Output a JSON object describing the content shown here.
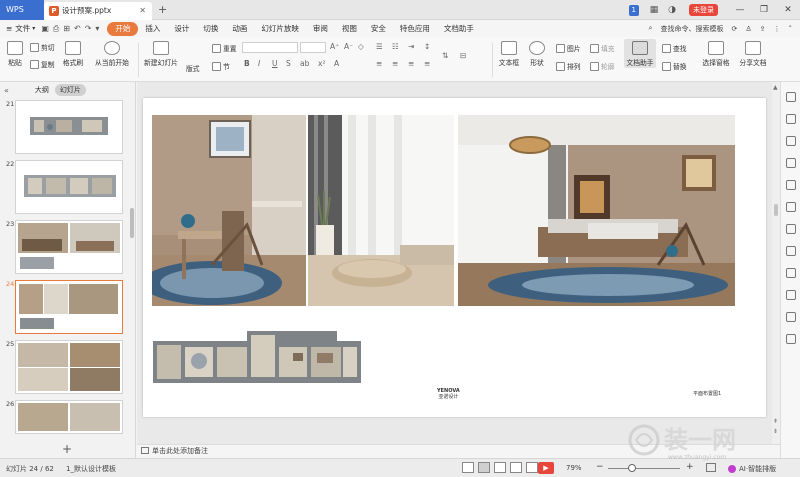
{
  "titlebar": {
    "app_name": "WPS",
    "doc_tab_label": "设计预案.pptx",
    "page_badge": "1",
    "login_label": "未登录"
  },
  "menubar": {
    "file_label": "文件",
    "items": [
      "开始",
      "插入",
      "设计",
      "切换",
      "动画",
      "幻灯片放映",
      "审阅",
      "视图",
      "安全",
      "特色应用",
      "文档助手"
    ],
    "active_index": 0,
    "search_label": "查找命令、搜索模板"
  },
  "ribbon": {
    "paste": "粘贴",
    "cut": "剪切",
    "copy": "复制",
    "format_painter": "格式刷",
    "from_current": "从当前开始",
    "new_slide": "新建幻灯片",
    "layout": "版式",
    "reset": "重置",
    "section": "节",
    "textbox": "文本框",
    "shape": "形状",
    "picture": "图片",
    "fill": "填充",
    "arrange": "排列",
    "outline": "轮廓",
    "doc_assistant": "文档助手",
    "find": "查找",
    "replace": "替换",
    "select_pane": "选择窗格",
    "share_doc": "分享文档"
  },
  "leftpanel": {
    "tab_outline": "大纲",
    "tab_slides": "幻灯片",
    "thumbnails": [
      {
        "num": "21",
        "current": false
      },
      {
        "num": "22",
        "current": false
      },
      {
        "num": "23",
        "current": false
      },
      {
        "num": "24",
        "current": true
      },
      {
        "num": "25",
        "current": false
      },
      {
        "num": "26",
        "current": false
      }
    ],
    "add_label": "+"
  },
  "slide": {
    "logo_text": "YENOVA",
    "logo_sub": "亚诺设计",
    "caption": "平面布置图1"
  },
  "notes": {
    "placeholder": "单击此处添加备注"
  },
  "statusbar": {
    "slide_counter": "幻灯片 24 / 62",
    "theme_name": "1_默认设计模板",
    "zoom": "79%",
    "ai_label": "AI·智能排版"
  },
  "watermark": {
    "text": "装一网",
    "url": "www.zhuangyi.com"
  },
  "colors": {
    "accent_orange": "#e97a3e",
    "wps_blue": "#3a6fd0",
    "play_red": "#e8463b"
  }
}
